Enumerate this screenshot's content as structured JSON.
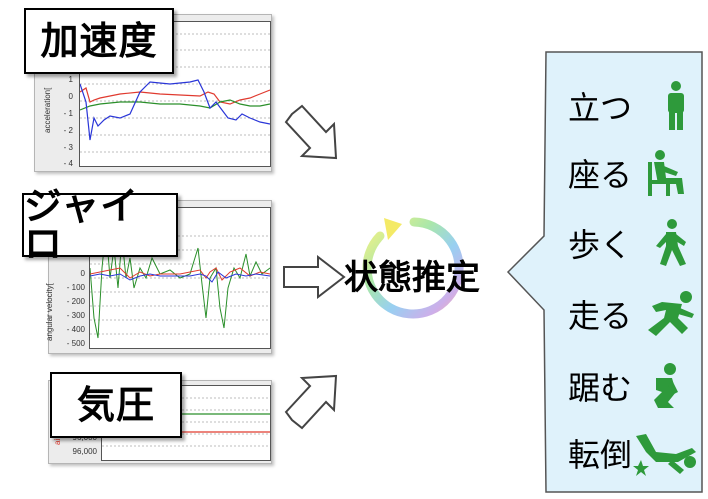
{
  "sensors": [
    {
      "label": "加速度",
      "ylabel": "acceleration[",
      "ticks": [
        "1",
        "0",
        "- 1",
        "- 2",
        "- 3",
        "- 4"
      ]
    },
    {
      "label": "ジャイロ",
      "ylabel": "angular velocity[",
      "ticks": [
        "0",
        "- 100",
        "- 200",
        "- 300",
        "- 400",
        "- 500"
      ]
    },
    {
      "label": "気圧",
      "ylabel": "ai",
      "ticks": [
        "96,000",
        "96,000"
      ]
    }
  ],
  "center": {
    "label": "状態推定"
  },
  "states": [
    {
      "label": "立つ",
      "icon": "standing-person-icon"
    },
    {
      "label": "座る",
      "icon": "sitting-person-icon"
    },
    {
      "label": "歩く",
      "icon": "walking-person-icon"
    },
    {
      "label": "走る",
      "icon": "running-person-icon"
    },
    {
      "label": "踞む",
      "icon": "crouching-person-icon"
    },
    {
      "label": "転倒",
      "icon": "falling-person-icon"
    }
  ],
  "colors": {
    "panel_bg": "#dff2fb",
    "icon_green": "#2e9a3b",
    "series_red": "#e03a2f",
    "series_blue": "#2a36d8",
    "series_green": "#2a8f2a"
  }
}
